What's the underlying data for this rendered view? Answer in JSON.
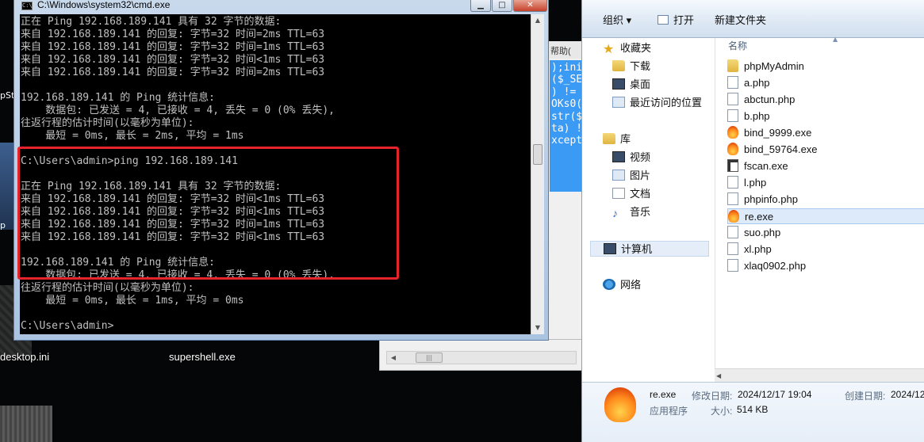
{
  "desktop": {
    "left_text_1": "pSt",
    "left_text_2": "p",
    "desktop_ini": "desktop.ini",
    "supershell": "supershell.exe"
  },
  "editor": {
    "tab_label": "帮助(",
    "code_lines": [
      ");ini",
      "($_SE",
      ") !=",
      "OKs0(",
      "str($",
      "ta) !",
      "xcept"
    ]
  },
  "cmd": {
    "title": "C:\\Windows\\system32\\cmd.exe",
    "min_glyph": "▁",
    "max_glyph": "□",
    "close_glyph": "✕",
    "lines": [
      "正在 Ping 192.168.189.141 具有 32 字节的数据:",
      "来自 192.168.189.141 的回复: 字节=32 时间=2ms TTL=63",
      "来自 192.168.189.141 的回复: 字节=32 时间=1ms TTL=63",
      "来自 192.168.189.141 的回复: 字节=32 时间<1ms TTL=63",
      "来自 192.168.189.141 的回复: 字节=32 时间=2ms TTL=63",
      "",
      "192.168.189.141 的 Ping 统计信息:",
      "    数据包: 已发送 = 4, 已接收 = 4, 丢失 = 0 (0% 丢失),",
      "往返行程的估计时间(以毫秒为单位):",
      "    最短 = 0ms, 最长 = 2ms, 平均 = 1ms",
      "",
      "C:\\Users\\admin>ping 192.168.189.141",
      "",
      "正在 Ping 192.168.189.141 具有 32 字节的数据:",
      "来自 192.168.189.141 的回复: 字节=32 时间<1ms TTL=63",
      "来自 192.168.189.141 的回复: 字节=32 时间<1ms TTL=63",
      "来自 192.168.189.141 的回复: 字节=32 时间=1ms TTL=63",
      "来自 192.168.189.141 的回复: 字节=32 时间<1ms TTL=63",
      "",
      "192.168.189.141 的 Ping 统计信息:",
      "    数据包: 已发送 = 4, 已接收 = 4, 丢失 = 0 (0% 丢失),",
      "往返行程的估计时间(以毫秒为单位):",
      "    最短 = 0ms, 最长 = 1ms, 平均 = 0ms",
      "",
      "C:\\Users\\admin>"
    ],
    "highlight_color": "#e5232a"
  },
  "explorer": {
    "toolbar": {
      "organize": "组织 ▾",
      "open": "打开",
      "new_folder": "新建文件夹"
    },
    "nav": {
      "favorites": "收藏夹",
      "downloads": "下载",
      "desktop": "桌面",
      "recent": "最近访问的位置",
      "libraries": "库",
      "videos": "视频",
      "pictures": "图片",
      "documents": "文档",
      "music": "音乐",
      "computer": "计算机",
      "network": "网络"
    },
    "column_name": "名称",
    "files": [
      {
        "name": "phpMyAdmin",
        "icon": "folder-icon"
      },
      {
        "name": "a.php",
        "icon": "php-file-icon"
      },
      {
        "name": "abctun.php",
        "icon": "php-file-icon"
      },
      {
        "name": "b.php",
        "icon": "php-file-icon"
      },
      {
        "name": "bind_9999.exe",
        "icon": "exe-flame-icon"
      },
      {
        "name": "bind_59764.exe",
        "icon": "exe-flame-icon"
      },
      {
        "name": "fscan.exe",
        "icon": "scanner-exe-icon"
      },
      {
        "name": "l.php",
        "icon": "php-file-icon"
      },
      {
        "name": "phpinfo.php",
        "icon": "php-file-icon"
      },
      {
        "name": "re.exe",
        "icon": "exe-flame-icon"
      },
      {
        "name": "suo.php",
        "icon": "php-file-icon"
      },
      {
        "name": "xl.php",
        "icon": "php-file-icon"
      },
      {
        "name": "xlaq0902.php",
        "icon": "php-file-icon"
      }
    ],
    "selected_file": "re.exe",
    "details": {
      "name": "re.exe",
      "type": "应用程序",
      "modified_label": "修改日期:",
      "modified_value": "2024/12/17 19:04",
      "size_label": "大小:",
      "size_value": "514 KB",
      "created_label": "创建日期:",
      "created_value": "2024/12"
    }
  }
}
